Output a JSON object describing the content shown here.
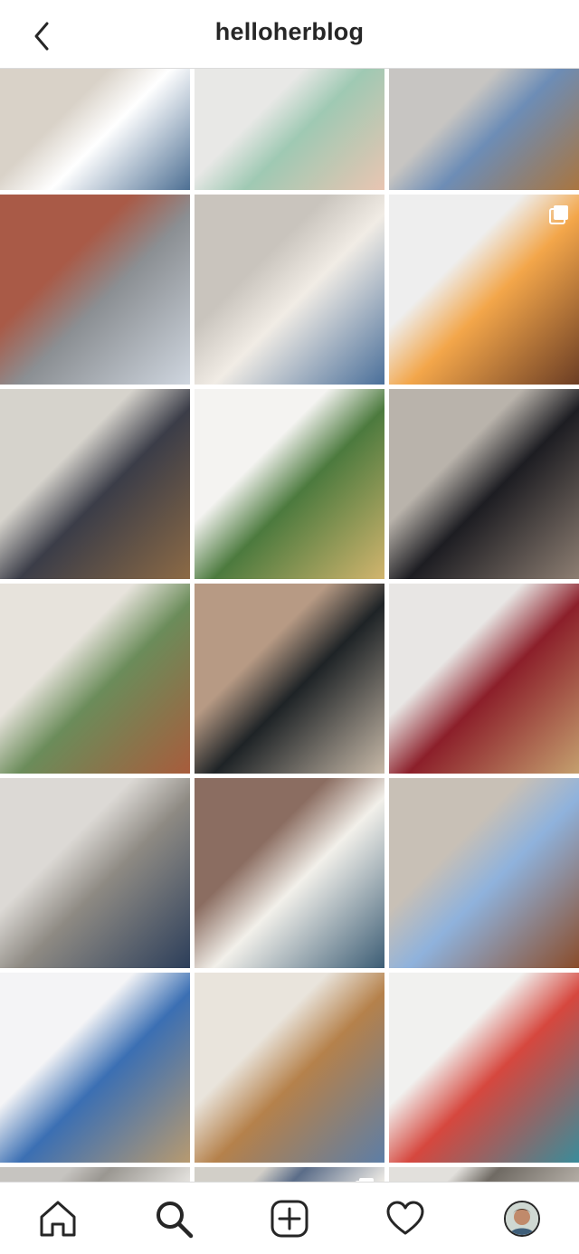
{
  "header": {
    "title": "helloherblog",
    "back_icon": "chevron-left-icon"
  },
  "grid": {
    "items": [
      {
        "name": "post-white-blouse",
        "colors": [
          "#d9d2c8",
          "#ffffff",
          "#4d6f93"
        ]
      },
      {
        "name": "post-skincare-tray",
        "colors": [
          "#e8e8e6",
          "#9fc9b3",
          "#e9c5b2"
        ]
      },
      {
        "name": "post-street-jeans",
        "colors": [
          "#c7c5c2",
          "#6d8db6",
          "#a9753f"
        ]
      },
      {
        "name": "post-brick-house",
        "colors": [
          "#a95a47",
          "#8b8f93",
          "#cfd6df"
        ]
      },
      {
        "name": "post-steps-sitting",
        "colors": [
          "#c9c4bd",
          "#f1ece5",
          "#4a6f9a"
        ]
      },
      {
        "name": "post-dairy-almond-shake",
        "colors": [
          "#eeeeee",
          "#f3a64a",
          "#6b3d24"
        ]
      },
      {
        "name": "post-couch-dog",
        "colors": [
          "#d6d3cc",
          "#3b3d48",
          "#8c6a45"
        ]
      },
      {
        "name": "post-candle-plant",
        "colors": [
          "#f4f3f1",
          "#4c7a3e",
          "#d2b56e"
        ]
      },
      {
        "name": "post-street-walk",
        "colors": [
          "#b9b3ab",
          "#1d1d22",
          "#8d7e72"
        ]
      },
      {
        "name": "post-living-room",
        "colors": [
          "#e7e3dc",
          "#6b8c5a",
          "#a85c3c"
        ]
      },
      {
        "name": "post-black-outfit",
        "colors": [
          "#b79a84",
          "#1e2326",
          "#c7b9a8"
        ]
      },
      {
        "name": "post-nail-polish",
        "colors": [
          "#e8e6e4",
          "#8c1f2a",
          "#c49f6e"
        ]
      },
      {
        "name": "post-plaid-blazer",
        "colors": [
          "#dcd9d5",
          "#8e8a83",
          "#2c3e5a"
        ]
      },
      {
        "name": "post-reading-book",
        "colors": [
          "#8b6d61",
          "#f2f0ea",
          "#3c5d75"
        ]
      },
      {
        "name": "post-blue-sweater",
        "colors": [
          "#c8c0b6",
          "#8fb2dc",
          "#8a4c2a"
        ]
      },
      {
        "name": "post-dog-birthday",
        "colors": [
          "#f4f4f6",
          "#3b6fb3",
          "#b79a70"
        ]
      },
      {
        "name": "post-bathroom-vanity",
        "colors": [
          "#e9e4dc",
          "#b5814b",
          "#5d7ea6"
        ]
      },
      {
        "name": "post-book-stack",
        "colors": [
          "#f1f1ef",
          "#d6473e",
          "#3a8c9a"
        ]
      },
      {
        "name": "post-partial-1",
        "colors": [
          "#c6c4c0",
          "#9a9791",
          "#e4e2de"
        ]
      },
      {
        "name": "post-partial-2",
        "colors": [
          "#d2cfc8",
          "#5a6c88",
          "#efece6"
        ]
      },
      {
        "name": "post-partial-3",
        "colors": [
          "#e2e0dc",
          "#6f6a63",
          "#b3ada5"
        ]
      }
    ]
  },
  "badges": {
    "multi_icon": "multiple-posts-icon"
  },
  "bottom_nav": {
    "home": "home-icon",
    "search": "search-icon",
    "add": "add-post-icon",
    "activity": "heart-icon",
    "profile": "profile-avatar"
  },
  "colors": {
    "border": "#dbdbdb",
    "icon": "#262626"
  }
}
